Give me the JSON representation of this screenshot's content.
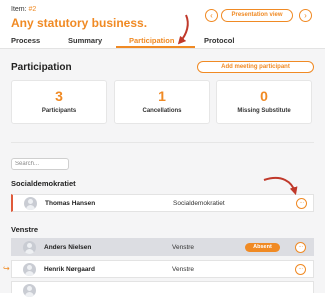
{
  "header": {
    "item_label": "Item:",
    "item_number": "#2",
    "title": "Any statutory business.",
    "presentation_view_label": "Presentation view",
    "prev_icon": "chevron-left-icon",
    "next_icon": "chevron-right-icon"
  },
  "tabs": [
    {
      "label": "Process"
    },
    {
      "label": "Summary"
    },
    {
      "label": "Participation",
      "active": true
    },
    {
      "label": "Protocol"
    }
  ],
  "participation": {
    "title": "Participation",
    "add_button_label": "Add meeting participant",
    "stats": [
      {
        "value": "3",
        "label": "Participants"
      },
      {
        "value": "1",
        "label": "Cancellations"
      },
      {
        "value": "0",
        "label": "Missing Substitute"
      }
    ],
    "search_placeholder": "Search...",
    "groups": [
      {
        "name": "Socialdemokratiet",
        "participants": [
          {
            "name": "Thomas Hansen",
            "party": "Socialdemokratiet",
            "more_label": "···"
          }
        ]
      },
      {
        "name": "Venstre",
        "participants": [
          {
            "name": "Anders Nielsen",
            "party": "Venstre",
            "status": "Absent",
            "more_label": "···"
          },
          {
            "name": "Henrik Nørgaard",
            "party": "Venstre",
            "more_label": "···"
          }
        ]
      }
    ]
  },
  "colors": {
    "accent": "#f08a24",
    "annotation_arrow": "#c0392b",
    "selected_row": "#dcdde2",
    "background": "#f5f5f6"
  }
}
